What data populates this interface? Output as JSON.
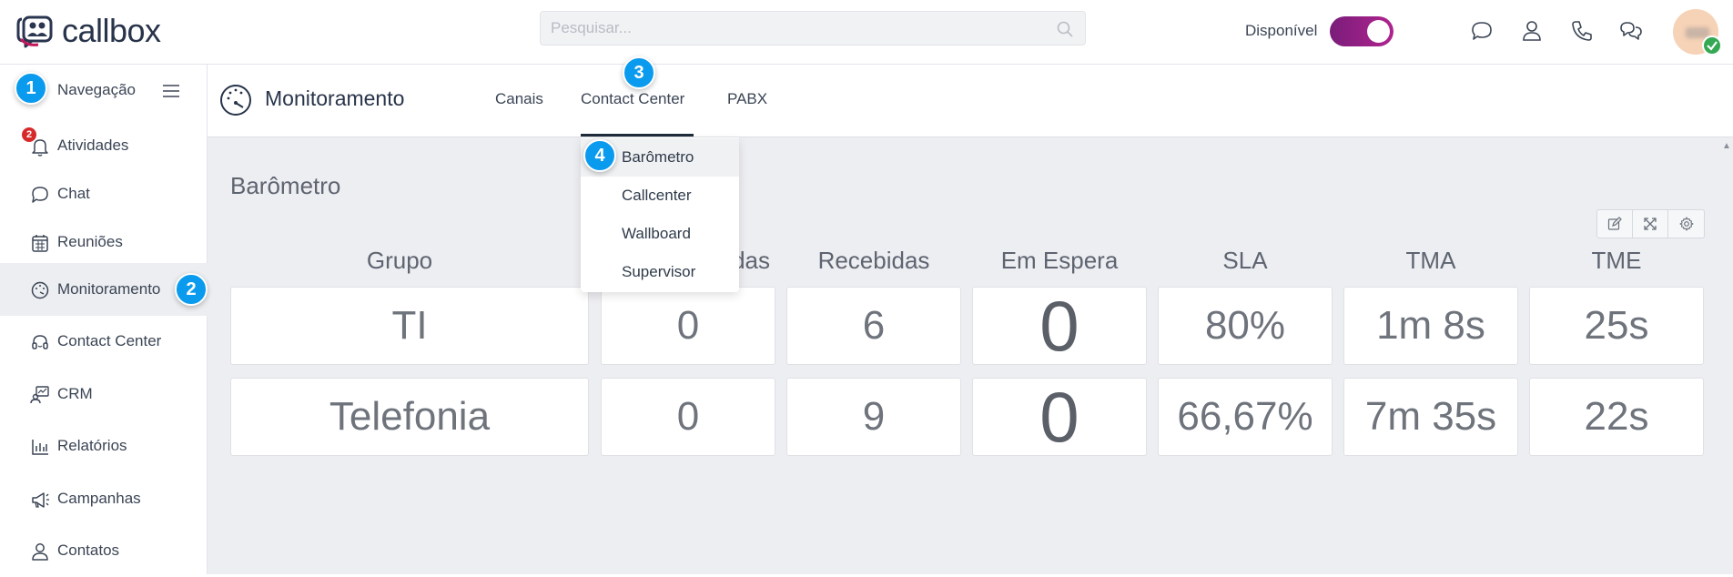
{
  "app": {
    "name": "callbox"
  },
  "search": {
    "placeholder": "Pesquisar..."
  },
  "status": {
    "label": "Disponível",
    "on": true
  },
  "sidebar": {
    "header": "Navegação",
    "items": [
      {
        "label": "Atividades",
        "icon": "bell-icon",
        "badge": "2"
      },
      {
        "label": "Chat",
        "icon": "chat-bubble-icon"
      },
      {
        "label": "Reuniões",
        "icon": "calendar-icon"
      },
      {
        "label": "Monitoramento",
        "icon": "gauge-icon",
        "active": true
      },
      {
        "label": "Contact Center",
        "icon": "headset-icon"
      },
      {
        "label": "CRM",
        "icon": "crm-icon"
      },
      {
        "label": "Relatórios",
        "icon": "bar-chart-icon"
      },
      {
        "label": "Campanhas",
        "icon": "megaphone-icon"
      },
      {
        "label": "Contatos",
        "icon": "person-icon"
      }
    ]
  },
  "steps": [
    "1",
    "2",
    "3",
    "4"
  ],
  "page": {
    "title": "Monitoramento",
    "tabs": [
      {
        "label": "Canais"
      },
      {
        "label": "Contact Center",
        "active": true
      },
      {
        "label": "PABX"
      }
    ],
    "dropdown": [
      "Barômetro",
      "Callcenter",
      "Wallboard",
      "Supervisor"
    ]
  },
  "barometro": {
    "title": "Barômetro",
    "columns": [
      "Grupo",
      "Atendidas",
      "Recebidas",
      "Em Espera",
      "SLA",
      "TMA",
      "TME"
    ],
    "column_partial_visible": "das",
    "rows": [
      [
        "TI",
        "0",
        "6",
        "0",
        "80%",
        "1m 8s",
        "25s"
      ],
      [
        "Telefonia",
        "0",
        "9",
        "0",
        "66,67%",
        "7m 35s",
        "22s"
      ]
    ]
  },
  "colors": {
    "accent": "#0a9aee",
    "toggle": "#a0228a",
    "badge": "#d62a2a"
  }
}
